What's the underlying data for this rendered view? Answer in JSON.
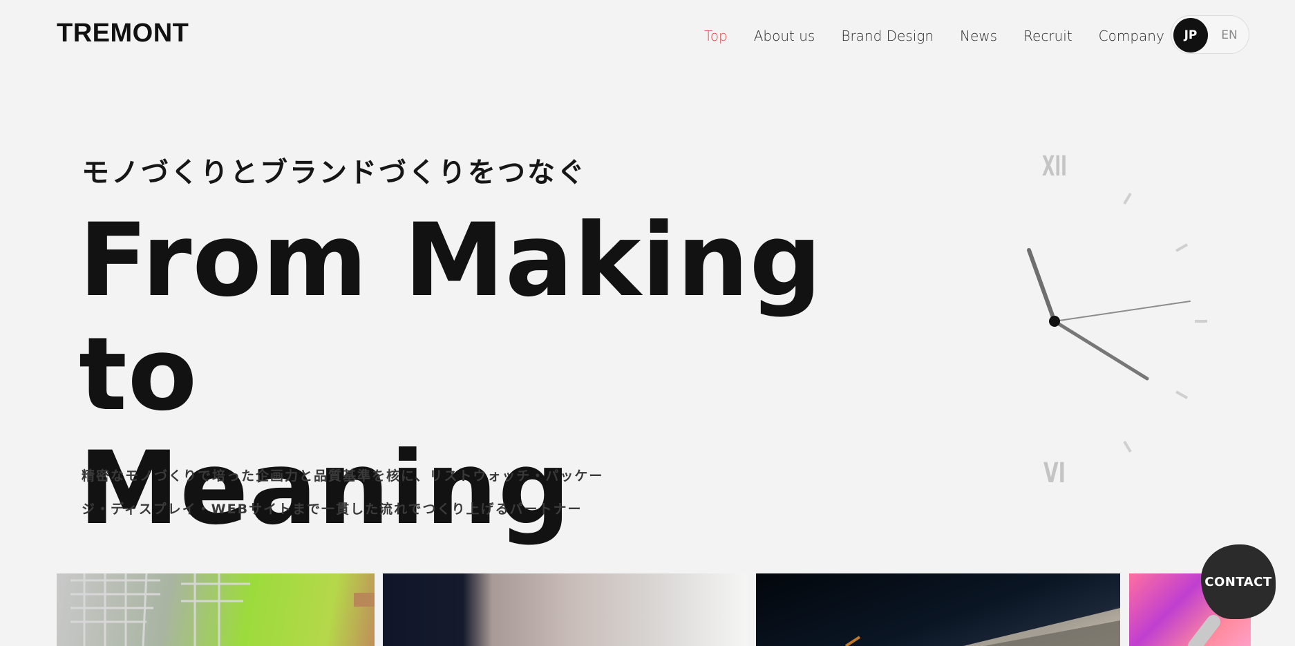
{
  "header": {
    "logo": "TREMONT",
    "nav": [
      {
        "label": "Top",
        "active": true
      },
      {
        "label": "About us",
        "active": false
      },
      {
        "label": "Brand Design",
        "active": false
      },
      {
        "label": "News",
        "active": false
      },
      {
        "label": "Recruit",
        "active": false
      },
      {
        "label": "Company",
        "active": false
      }
    ],
    "lang": {
      "jp": "JP",
      "en": "EN",
      "selected": "JP"
    }
  },
  "hero": {
    "subtitle": "モノづくりとブランドづくりをつなぐ",
    "title_line1": "From Making to",
    "title_line2": "Meaning",
    "desc_line1": "精密なモノづくりで培った企画力と品質基準を核に、リストウォッチ・パッケー",
    "desc_line2": "ジ・ディスプレイ・WEBサイトまで一貫した流れでつくり上げるパートナー"
  },
  "clock": {
    "numeral_top": "XII",
    "numeral_bottom": "VI"
  },
  "gallery": {
    "tiles": [
      "tile-1",
      "tile-2",
      "tile-3",
      "tile-4"
    ]
  },
  "contact_label": "CONTACT",
  "colors": {
    "background": "#f3f3f3",
    "accent": "#e2474b",
    "text": "#141414",
    "contact_bg": "#2b2b2b"
  }
}
